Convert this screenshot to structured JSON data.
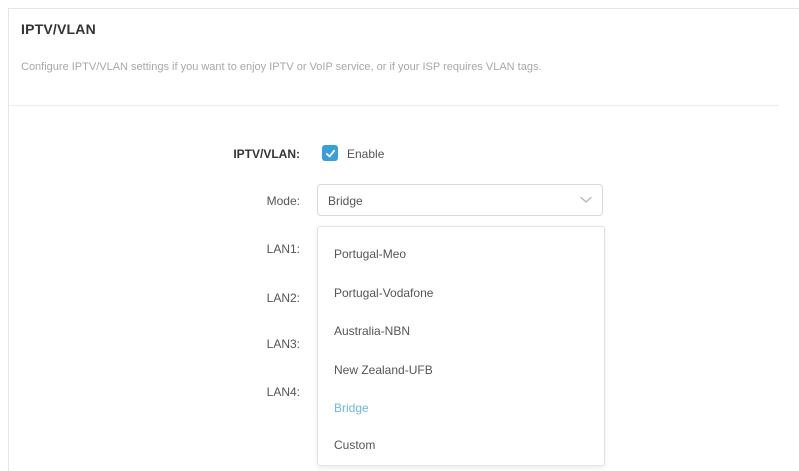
{
  "section": {
    "title": "IPTV/VLAN",
    "description": "Configure IPTV/VLAN settings if you want to enjoy IPTV or VoIP service, or if your ISP requires VLAN tags."
  },
  "form": {
    "iptv_label": "IPTV/VLAN:",
    "enable_label": "Enable",
    "enable_checked": true,
    "mode_label": "Mode:",
    "mode_value": "Bridge",
    "lan_labels": [
      "LAN1:",
      "LAN2:",
      "LAN3:",
      "LAN4:"
    ]
  },
  "mode_dropdown": {
    "options": [
      "Portugal-Meo",
      "Portugal-Vodafone",
      "Australia-NBN",
      "New Zealand-UFB",
      "Bridge",
      "Custom"
    ],
    "selected": "Bridge"
  },
  "colors": {
    "accent": "#3a9fd9",
    "selected_option": "#6fb6e6"
  },
  "icons": {
    "checkbox": "check-icon",
    "select": "chevron-down-icon"
  }
}
